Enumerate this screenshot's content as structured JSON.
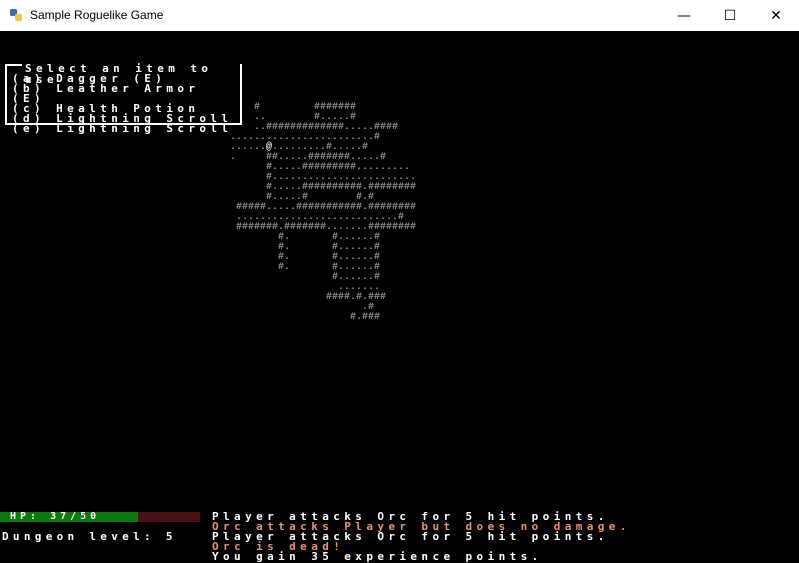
{
  "window": {
    "title": "Sample Roguelike Game",
    "minimize_glyph": "—",
    "maximize_glyph": "☐",
    "close_glyph": "✕"
  },
  "map": {
    "rows": [
      "    #         #######           ",
      "    ..        #.....#           ",
      "    ..#############.....####    ",
      "........................#       ",
      "......@.........#.....#         ",
      ".     ##.....#######.....#      ",
      "      #.....#########.........  ",
      "      #........................ ",
      "      #.....##########.######## ",
      "      #.....#        #.#        ",
      " #####.....###########.######## ",
      " ...........................#   ",
      " #######.#######.......######## ",
      "        #.       #......#       ",
      "        #.       #......#       ",
      "        #.       #......#       ",
      "        #.       #......#       ",
      "                 #......#       ",
      "                  .......       ",
      "                ####.#.###      ",
      "                      .#        ",
      "                    #.###       "
    ],
    "player_glyph": "@"
  },
  "inventory": {
    "title": "Select an item to use",
    "items": [
      "(a) Dagger (E)",
      "(b) Leather Armor (E)",
      "(c) Health Potion",
      "(d) Lightning Scroll",
      "(e) Lightning Scroll"
    ]
  },
  "status": {
    "hp_label": "HP: 37/50",
    "hp_current": 37,
    "hp_max": 50,
    "dungeon_level": "Dungeon level: 5"
  },
  "log": [
    {
      "text": "Player attacks Orc for 5 hit points.",
      "color": "#ffffff"
    },
    {
      "text": "Orc attacks Player but does no damage.",
      "color": "#e9936b"
    },
    {
      "text": "Player attacks Orc for 5 hit points.",
      "color": "#ffffff"
    },
    {
      "text": "Orc is dead!",
      "color": "#e9936b"
    },
    {
      "text": "You gain 35 experience points.",
      "color": "#ffffff"
    }
  ],
  "colors": {
    "hp_fill": "#0a7a0a",
    "hp_empty": "#4a1212",
    "map": "#9a9a9a"
  }
}
